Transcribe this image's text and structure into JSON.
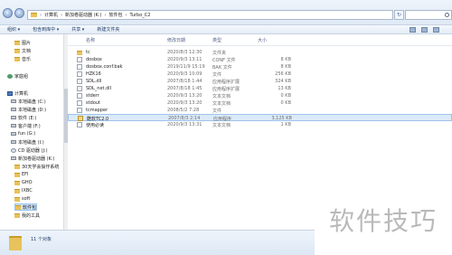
{
  "address": {
    "crumbs": [
      "计算机",
      "新加卷驱动器 (K:)",
      "软件包",
      "Turbo_C2"
    ],
    "search_placeholder": ""
  },
  "toolbar": {
    "organize": "组织 ▾",
    "include": "包含到库中 ▾",
    "share": "共享 ▾",
    "new_folder": "新建文件夹"
  },
  "sidebar": {
    "items": [
      {
        "label": "图片",
        "icon": "folder-icon"
      },
      {
        "label": "文档",
        "icon": "folder-icon"
      },
      {
        "label": "音乐",
        "icon": "folder-icon"
      },
      {
        "label": "家庭组",
        "icon": "homegroup-icon"
      },
      {
        "label": "计算机",
        "icon": "computer-icon"
      },
      {
        "label": "本地磁盘 (C:)",
        "icon": "drive-icon"
      },
      {
        "label": "本地磁盘 (D:)",
        "icon": "drive-icon"
      },
      {
        "label": "软件 (E:)",
        "icon": "drive-icon"
      },
      {
        "label": "客户端 (F:)",
        "icon": "drive-icon"
      },
      {
        "label": "fun (G:)",
        "icon": "drive-icon"
      },
      {
        "label": "本地磁盘 (I:)",
        "icon": "drive-icon"
      },
      {
        "label": "CD 驱动器 (J:)",
        "icon": "cd-icon"
      },
      {
        "label": "新加卷驱动器 (K:)",
        "icon": "drive-icon"
      },
      {
        "label": "30天学会操作系统",
        "icon": "folder-icon"
      },
      {
        "label": "EFI",
        "icon": "folder-icon"
      },
      {
        "label": "GHO",
        "icon": "folder-icon"
      },
      {
        "label": "IXBC",
        "icon": "folder-icon"
      },
      {
        "label": "soft",
        "icon": "folder-icon"
      },
      {
        "label": "软件包",
        "icon": "folder-icon"
      },
      {
        "label": "我的工具",
        "icon": "folder-icon"
      }
    ]
  },
  "columns": {
    "name": "名称",
    "date": "修改日期",
    "type": "类型",
    "size": "大小"
  },
  "files": [
    {
      "name": "tc",
      "date": "2020/8/3 12:30",
      "type": "文件夹",
      "size": "",
      "icon": "folder-icon"
    },
    {
      "name": "dosbox",
      "date": "2020/9/3 13:11",
      "type": "CONF 文件",
      "size": "8 KB",
      "icon": "file-icon"
    },
    {
      "name": "dosbox.conf.bak",
      "date": "2019/11/9 15:19",
      "type": "BAK 文件",
      "size": "8 KB",
      "icon": "file-icon"
    },
    {
      "name": "HZK16",
      "date": "2020/9/3 10:09",
      "type": "文件",
      "size": "256 KB",
      "icon": "file-icon"
    },
    {
      "name": "SDL.dll",
      "date": "2007/8/18 1:44",
      "type": "应用程序扩展",
      "size": "324 KB",
      "icon": "dll-icon"
    },
    {
      "name": "SDL_net.dll",
      "date": "2007/8/18 1:45",
      "type": "应用程序扩展",
      "size": "13 KB",
      "icon": "dll-icon"
    },
    {
      "name": "stderr",
      "date": "2020/9/3 13:20",
      "type": "文本文档",
      "size": "0 KB",
      "icon": "file-icon"
    },
    {
      "name": "stdout",
      "date": "2020/9/3 13:20",
      "type": "文本文档",
      "size": "0 KB",
      "icon": "file-icon"
    },
    {
      "name": "tcmapper",
      "date": "2008/5/2 7:28",
      "type": "文件",
      "size": "",
      "icon": "file-icon"
    },
    {
      "name": "酷软TC2.0",
      "date": "2007/8/3 2:14",
      "type": "应用程序",
      "size": "3,125 KB",
      "icon": "tc-app-icon",
      "selected": true
    },
    {
      "name": "使用必读",
      "date": "2020/9/3 13:31",
      "type": "文本文档",
      "size": "1 KB",
      "icon": "file-icon"
    }
  ],
  "status": {
    "text": "11 个对象"
  },
  "watermark": {
    "text": "软件技巧"
  }
}
